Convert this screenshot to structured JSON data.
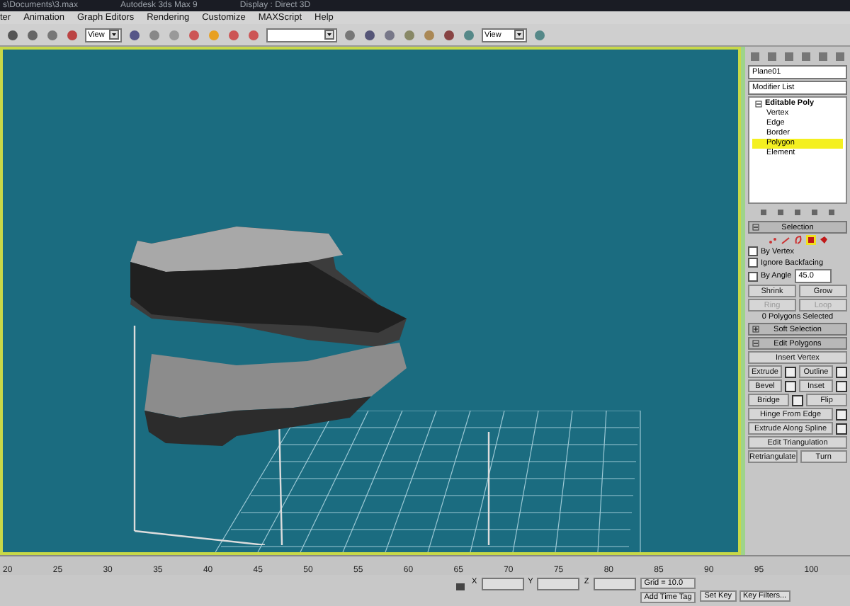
{
  "window": {
    "title_parts": [
      "s\\Documents\\3.max",
      "Autodesk 3ds Max 9",
      "Display : Direct 3D"
    ]
  },
  "menu": [
    "ter",
    "Animation",
    "Graph Editors",
    "Rendering",
    "Customize",
    "MAXScript",
    "Help"
  ],
  "toolbar": {
    "dropdowns": [
      "View",
      "View"
    ]
  },
  "command_panel": {
    "object_name": "Plane01",
    "modifier_list": "Modifier List",
    "stack": [
      {
        "label": "Editable Poly",
        "expanded": true,
        "children": [
          {
            "label": "Vertex",
            "selected": false
          },
          {
            "label": "Edge",
            "selected": false
          },
          {
            "label": "Border",
            "selected": false
          },
          {
            "label": "Polygon",
            "selected": true
          },
          {
            "label": "Element",
            "selected": false
          }
        ]
      }
    ],
    "selection": {
      "title": "Selection",
      "expanded": true,
      "levels": [
        {
          "kind": "vertex",
          "selected": false
        },
        {
          "kind": "edge",
          "selected": false
        },
        {
          "kind": "border",
          "selected": false
        },
        {
          "kind": "polygon",
          "selected": true
        },
        {
          "kind": "element",
          "selected": false
        }
      ],
      "options": [
        {
          "label": "By Vertex",
          "checked": false
        },
        {
          "label": "Ignore Backfacing",
          "checked": false
        },
        {
          "label": "By Angle",
          "checked": false,
          "value": "45.0"
        }
      ],
      "buttons": [
        {
          "label": "Shrink",
          "disabled": false
        },
        {
          "label": "Grow",
          "disabled": false
        },
        {
          "label": "Ring",
          "disabled": true
        },
        {
          "label": "Loop",
          "disabled": true
        }
      ],
      "status": "0 Polygons Selected"
    },
    "rollouts": [
      {
        "title": "Soft Selection",
        "expanded": false
      },
      {
        "title": "Edit Polygons",
        "expanded": true
      }
    ],
    "edit_polygons": [
      [
        {
          "label": "Insert Vertex",
          "settings": false
        }
      ],
      [
        {
          "label": "Extrude",
          "settings": true
        },
        {
          "label": "Outline",
          "settings": true
        }
      ],
      [
        {
          "label": "Bevel",
          "settings": true
        },
        {
          "label": "Inset",
          "settings": true
        }
      ],
      [
        {
          "label": "Bridge",
          "settings": true
        },
        {
          "label": "Flip",
          "settings": false
        }
      ],
      [
        {
          "label": "Hinge From Edge",
          "settings": true
        }
      ],
      [
        {
          "label": "Extrude Along Spline",
          "settings": true
        }
      ],
      [
        {
          "label": "Edit Triangulation",
          "settings": false
        }
      ],
      [
        {
          "label": "Retriangulate",
          "settings": false
        },
        {
          "label": "Turn",
          "settings": false
        }
      ]
    ]
  },
  "timeline": {
    "ticks": [
      "20",
      "25",
      "30",
      "35",
      "40",
      "45",
      "50",
      "55",
      "60",
      "65",
      "70",
      "75",
      "80",
      "85",
      "90",
      "95",
      "100"
    ]
  },
  "status_bar": {
    "coords": [
      "X",
      "Y",
      "Z"
    ],
    "grid": "Grid = 10.0",
    "time_tag": "Add Time Tag",
    "set_key": "Set Key",
    "key_filters": "Key Filters..."
  }
}
